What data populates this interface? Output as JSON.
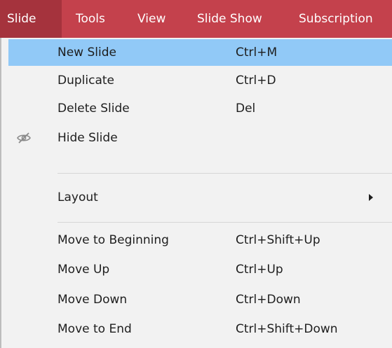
{
  "menubar": {
    "items": [
      {
        "label": "Slide",
        "active": true
      },
      {
        "label": "Tools"
      },
      {
        "label": "View"
      },
      {
        "label": "Slide Show"
      },
      {
        "label": "Subscription"
      }
    ]
  },
  "menu": {
    "items": [
      {
        "label": "New Slide",
        "shortcut": "Ctrl+M",
        "highlighted": true
      },
      {
        "label": "Duplicate",
        "shortcut": "Ctrl+D"
      },
      {
        "label": "Delete Slide",
        "shortcut": "Del"
      },
      {
        "label": "Hide Slide",
        "shortcut": "",
        "icon": "hidden-eye-icon"
      },
      {
        "label": "Layout",
        "shortcut": "",
        "submenu": true
      },
      {
        "label": "Move to Beginning",
        "shortcut": "Ctrl+Shift+Up"
      },
      {
        "label": "Move Up",
        "shortcut": "Ctrl+Up"
      },
      {
        "label": "Move Down",
        "shortcut": "Ctrl+Down"
      },
      {
        "label": "Move to End",
        "shortcut": "Ctrl+Shift+Down"
      }
    ]
  },
  "colors": {
    "menubar_bg": "#c4414c",
    "menubar_active_bg": "#a5333d",
    "menu_bg": "#f2f2f2",
    "highlight_bg": "#91c9f7"
  }
}
